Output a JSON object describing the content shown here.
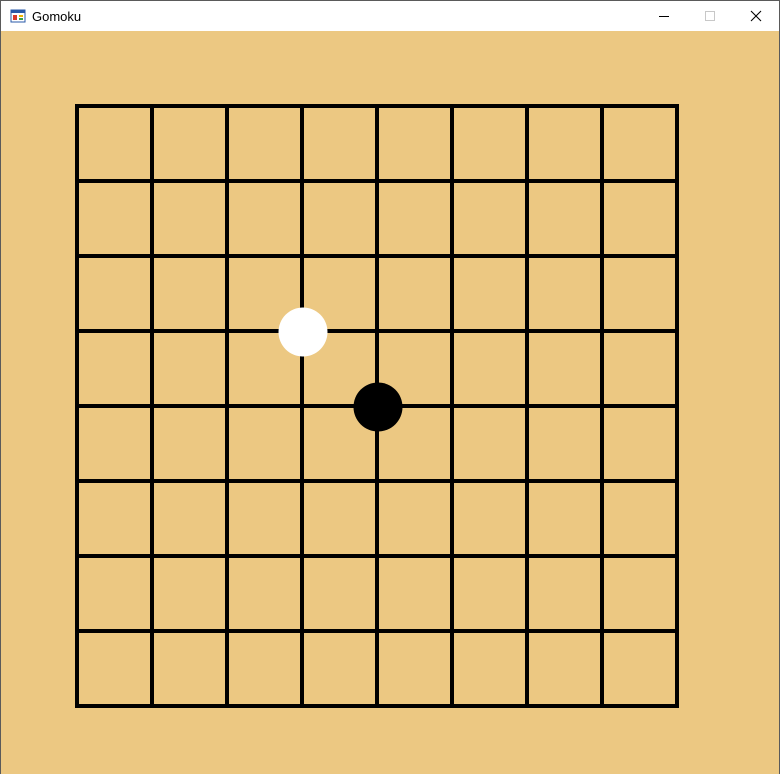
{
  "window": {
    "title": "Gomoku",
    "icon": "windows-form-icon",
    "controls": [
      "minimize-icon",
      "maximize-icon",
      "close-icon"
    ]
  },
  "board": {
    "background_color": "#ecc882",
    "line_color": "#000000",
    "cells": 8,
    "stones": [
      {
        "color": "white",
        "col": 3,
        "row": 3
      },
      {
        "color": "black",
        "col": 4,
        "row": 4
      }
    ]
  }
}
